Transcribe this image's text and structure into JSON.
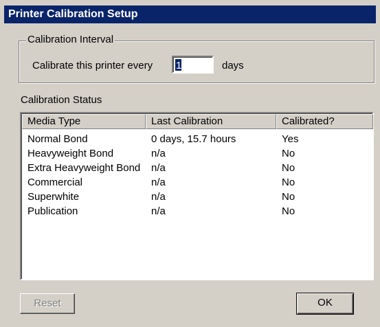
{
  "window": {
    "title": "Printer Calibration Setup"
  },
  "interval": {
    "group_label": "Calibration Interval",
    "prefix_label": "Calibrate this printer every",
    "value": "1",
    "suffix_label": "days"
  },
  "status": {
    "label": "Calibration Status",
    "columns": [
      "Media Type",
      "Last Calibration",
      "Calibrated?"
    ],
    "rows": [
      [
        "Normal Bond",
        "0 days, 15.7 hours",
        "Yes"
      ],
      [
        "Heavyweight Bond",
        "n/a",
        "No"
      ],
      [
        "Extra Heavyweight Bond",
        "n/a",
        "No"
      ],
      [
        "Commercial",
        "n/a",
        "No"
      ],
      [
        "Superwhite",
        "n/a",
        "No"
      ],
      [
        "Publication",
        "n/a",
        "No"
      ]
    ]
  },
  "buttons": {
    "reset": "Reset",
    "ok": "OK"
  }
}
